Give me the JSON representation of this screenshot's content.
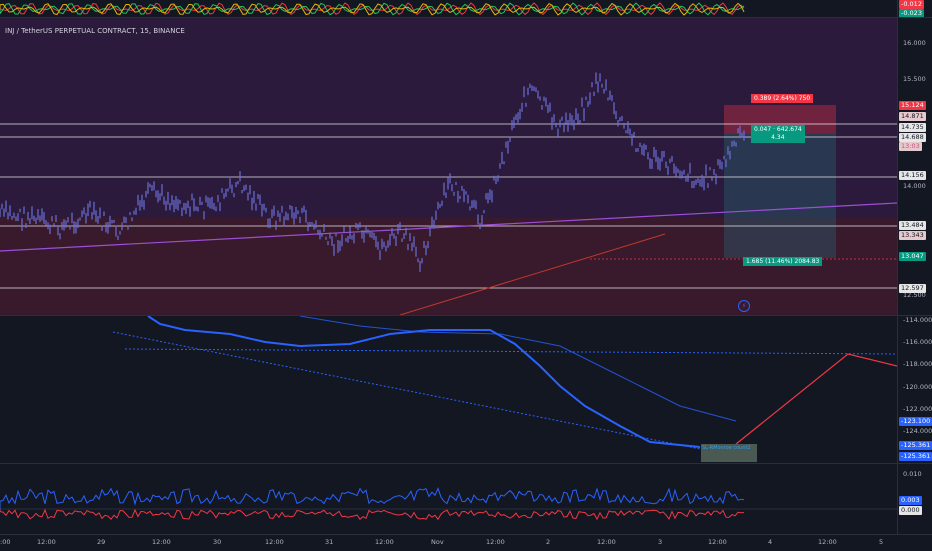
{
  "pane_title": "INJ / TetherUS PERPETUAL CONTRACT, 15, BINANCE",
  "top_badges": [
    "-0.012",
    "-0.023"
  ],
  "price_ticks": [
    "16.000",
    "15.500",
    "14.000",
    "12.500"
  ],
  "price_badges": [
    {
      "text": "15.124",
      "color": "#f23645"
    },
    {
      "text": "14.871",
      "color": "#e6c9cc"
    },
    {
      "text": "14.735",
      "color": "#e6e6e6"
    },
    {
      "text": "14.688",
      "color": "#e6e6e6"
    },
    {
      "text": "13:03",
      "color": "#e6c9cc"
    },
    {
      "text": "14.156",
      "color": "#e6e6e6"
    },
    {
      "text": "13.484",
      "color": "#e6e6e6"
    },
    {
      "text": "13.343",
      "color": "#e6c9cc"
    },
    {
      "text": "13.047",
      "color": "#089981"
    },
    {
      "text": "12.597",
      "color": "#e6e6e6"
    }
  ],
  "position_labels": {
    "top": "0.389 (2.64%) 750",
    "mid_line1": "0.047 · 642.674",
    "mid_line2": "4.34",
    "bottom": "1.685 (11.46%) 2084.83"
  },
  "osc_ticks": [
    "-114.000",
    "-116.000",
    "-118.000",
    "-120.000",
    "-122.000",
    "-124.000"
  ],
  "osc_badges": [
    {
      "text": "-123.100",
      "color": "#2962ff"
    },
    {
      "text": "-125.361",
      "color": "#2962ff"
    },
    {
      "text": "-125.361",
      "color": "#2962ff"
    }
  ],
  "osc_note": "SL-RMonroe\ncount2",
  "rsi_ticks": [
    "0.010"
  ],
  "rsi_badges": [
    {
      "text": "0.003",
      "color": "#2962ff"
    },
    {
      "text": "0.000",
      "color": "#e6e6e6"
    }
  ],
  "time_ticks": [
    "12:00",
    "29",
    "12:00",
    "30",
    "12:00",
    "31",
    "12:00",
    "Nov",
    "12:00",
    "2",
    "12:00",
    "3",
    "12:00",
    "4",
    "12:00",
    "5"
  ],
  "time_tick_first": ":00",
  "colors": {
    "bg": "#131722",
    "candles": "#6a6fd6",
    "red_zone": "#f23645",
    "green_zone": "#089981",
    "osc_line": "#2962ff",
    "osc_red": "#f23645"
  },
  "icons": {
    "alert": "bolt-icon"
  }
}
